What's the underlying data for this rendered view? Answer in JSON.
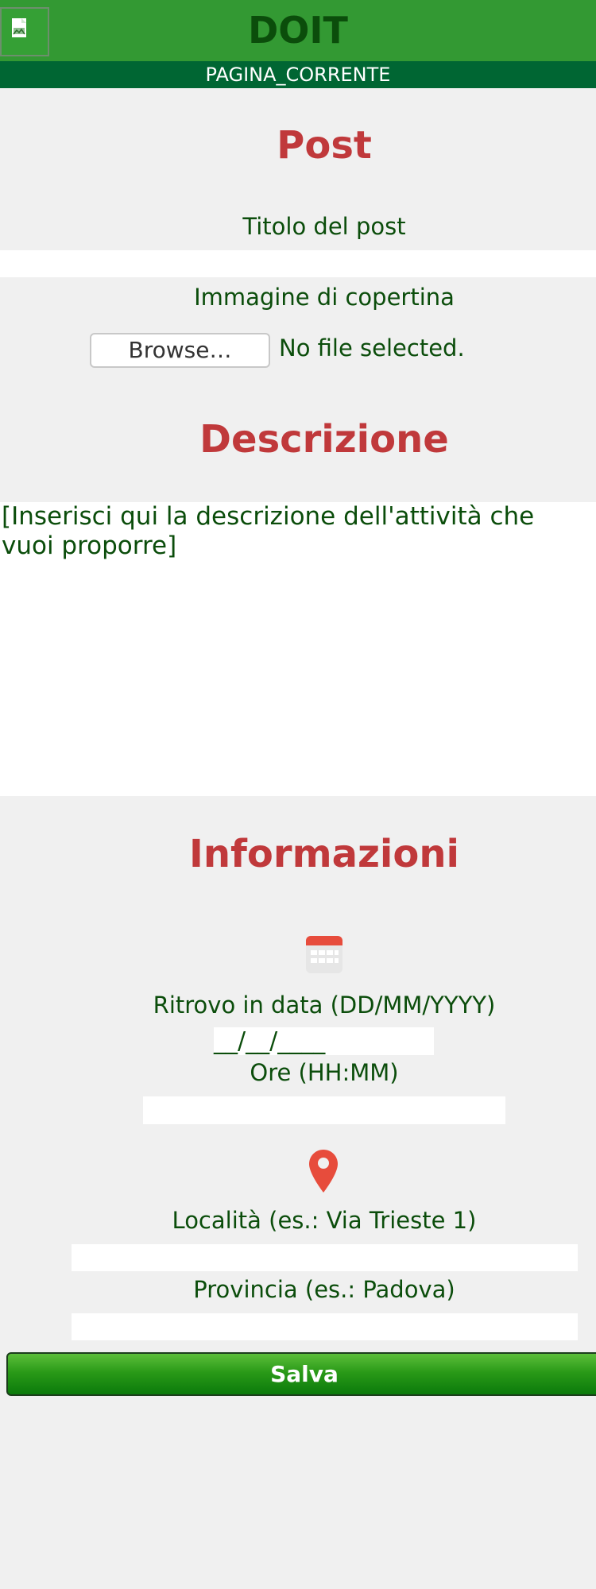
{
  "header": {
    "brand": "DOIT",
    "current_page": "PAGINA_CORRENTE"
  },
  "post_section": {
    "heading": "Post",
    "title_label": "Titolo del post",
    "title_value": "",
    "cover_label": "Immagine di copertina",
    "browse_label": "Browse…",
    "file_status": "No file selected."
  },
  "description_section": {
    "heading": "Descrizione",
    "textarea_value": "[Inserisci qui la descrizione dell'attività che vuoi proporre]"
  },
  "info_section": {
    "heading": "Informazioni",
    "calendar_icon": "calendar-icon",
    "date_label": "Ritrovo in data (DD/MM/YYYY)",
    "date_value": "__/__/____",
    "time_label": "Ore (HH:MM)",
    "time_value": "",
    "location_icon": "map-pin-icon",
    "location_label": "Località (es.: Via Trieste 1)",
    "location_value": "",
    "province_label": "Provincia (es.: Padova)",
    "province_value": ""
  },
  "actions": {
    "save_label": "Salva"
  },
  "colors": {
    "header_green": "#339933",
    "subbar_green": "#006633",
    "heading_red": "#c0393b",
    "text_green": "#0b4d0b",
    "icon_red": "#e74c3c"
  }
}
